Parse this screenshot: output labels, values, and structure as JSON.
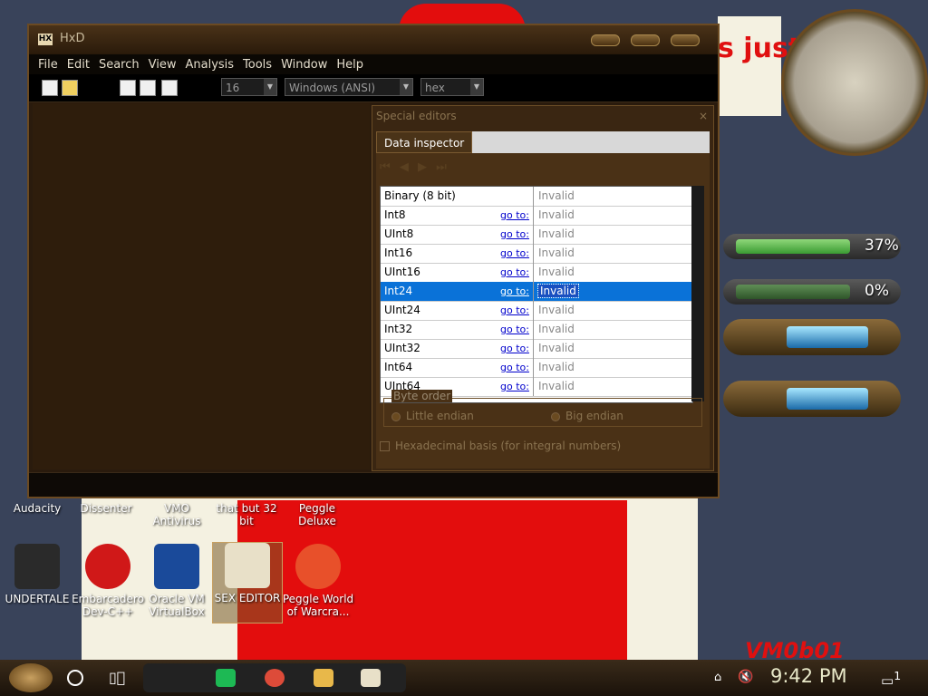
{
  "window": {
    "title": "HxD",
    "menu": [
      "File",
      "Edit",
      "Search",
      "View",
      "Analysis",
      "Tools",
      "Window",
      "Help"
    ],
    "toolbar": {
      "bytes_per_row": "16",
      "charset": "Windows (ANSI)",
      "display_mode": "hex"
    }
  },
  "special_editors": {
    "title": "Special editors",
    "close": "×",
    "tab": "Data inspector",
    "rows": [
      {
        "name": "Binary (8 bit)",
        "goto": "",
        "value": "Invalid"
      },
      {
        "name": "Int8",
        "goto": "go to:",
        "value": "Invalid"
      },
      {
        "name": "UInt8",
        "goto": "go to:",
        "value": "Invalid"
      },
      {
        "name": "Int16",
        "goto": "go to:",
        "value": "Invalid"
      },
      {
        "name": "UInt16",
        "goto": "go to:",
        "value": "Invalid"
      },
      {
        "name": "Int24",
        "goto": "go to:",
        "value": "Invalid"
      },
      {
        "name": "UInt24",
        "goto": "go to:",
        "value": "Invalid"
      },
      {
        "name": "Int32",
        "goto": "go to:",
        "value": "Invalid"
      },
      {
        "name": "UInt32",
        "goto": "go to:",
        "value": "Invalid"
      },
      {
        "name": "Int64",
        "goto": "go to:",
        "value": "Invalid"
      },
      {
        "name": "UInt64",
        "goto": "go to:",
        "value": "Invalid"
      }
    ],
    "byte_order_label": "Byte order",
    "little_endian": "Little endian",
    "big_endian": "Big endian",
    "hex_basis": "Hexadecimal basis (for integral numbers)"
  },
  "desktop": {
    "labels_row1": [
      "Audacity",
      "Dissenter",
      "VMO Antivirus",
      "that but 32 bit",
      "Peggle Deluxe"
    ],
    "icons_row2": [
      {
        "label": "UNDERTALE",
        "color": "#2a2a2a"
      },
      {
        "label": "Embarcadero Dev-C++",
        "color": "#d01818"
      },
      {
        "label": "Oracle VM VirtualBox",
        "color": "#1a4a9a"
      },
      {
        "label": "SEX EDITOR",
        "color": "#e8e0c8"
      },
      {
        "label": "Peggle World of Warcra...",
        "color": "#e8502a"
      }
    ],
    "watermark": "VM0b01",
    "cartoon_text": "s just like\n Or"
  },
  "widgets": {
    "meter1_pct": "37%",
    "meter1_fill": 0.37,
    "meter2_pct": "0%",
    "meter2_fill": 0.0
  },
  "taskbar": {
    "time": "9:42 PM",
    "notification_count": "1"
  }
}
